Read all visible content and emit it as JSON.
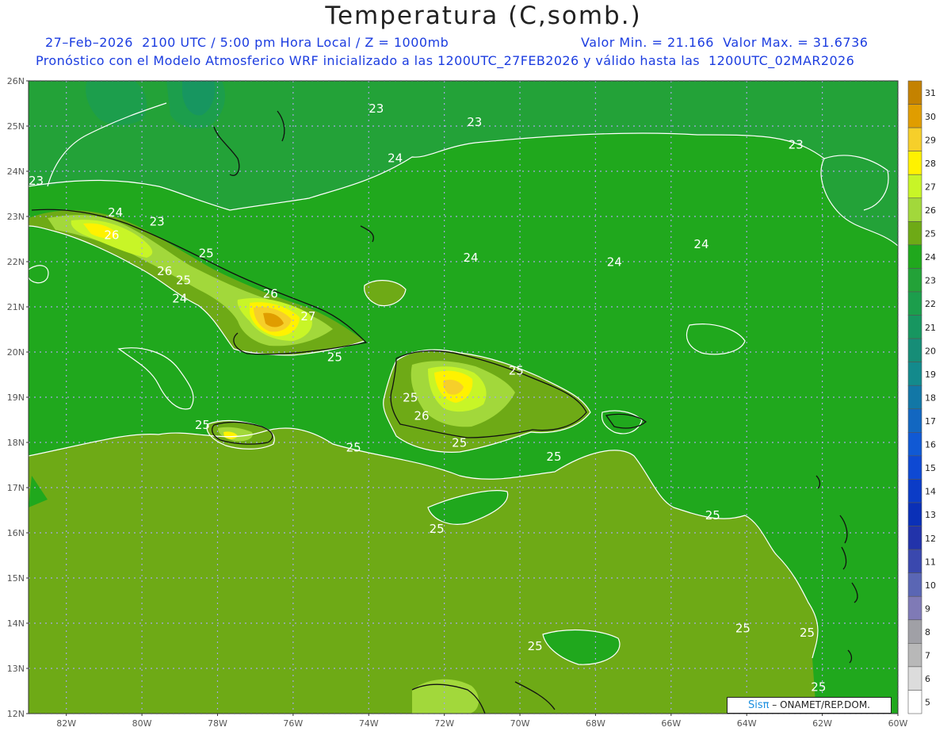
{
  "header": {
    "title": "Temperatura (C,somb.)",
    "line1_left": "27–Feb–2026  2100 UTC / 5:00 pm Hora Local / Z = 1000mb",
    "line1_right": "Valor Min. = 21.166  Valor Max. = 31.6736",
    "line2": "Pronóstico con el Modelo Atmosferico WRF inicializado a las 1200UTC_27FEB2026 y válido hasta las  1200UTC_02MAR2026"
  },
  "map": {
    "lat_range": [
      12,
      26
    ],
    "lon_range": [
      -83,
      -60
    ],
    "lat_labels": [
      "26N",
      "25N",
      "24N",
      "23N",
      "22N",
      "21N",
      "20N",
      "19N",
      "18N",
      "17N",
      "16N",
      "15N",
      "14N",
      "13N",
      "12N"
    ],
    "lon_labels": [
      "82W",
      "80W",
      "78W",
      "76W",
      "74W",
      "72W",
      "70W",
      "68W",
      "66W",
      "64W",
      "62W",
      "60W"
    ],
    "contour_labels": [
      {
        "text": "23",
        "lon": -82.8,
        "lat": 23.7
      },
      {
        "text": "23",
        "lon": -73.8,
        "lat": 25.3
      },
      {
        "text": "23",
        "lon": -71.2,
        "lat": 25.0
      },
      {
        "text": "23",
        "lon": -62.7,
        "lat": 24.5
      },
      {
        "text": "24",
        "lon": -73.3,
        "lat": 24.2
      },
      {
        "text": "24",
        "lon": -80.7,
        "lat": 23.0
      },
      {
        "text": "23",
        "lon": -79.6,
        "lat": 22.8
      },
      {
        "text": "26",
        "lon": -80.8,
        "lat": 22.5
      },
      {
        "text": "25",
        "lon": -78.3,
        "lat": 22.1
      },
      {
        "text": "26",
        "lon": -79.4,
        "lat": 21.7
      },
      {
        "text": "25",
        "lon": -78.9,
        "lat": 21.5
      },
      {
        "text": "24",
        "lon": -79.0,
        "lat": 21.1
      },
      {
        "text": "24",
        "lon": -71.3,
        "lat": 22.0
      },
      {
        "text": "24",
        "lon": -67.5,
        "lat": 21.9
      },
      {
        "text": "24",
        "lon": -65.2,
        "lat": 22.3
      },
      {
        "text": "26",
        "lon": -76.6,
        "lat": 21.2
      },
      {
        "text": "27",
        "lon": -75.6,
        "lat": 20.7
      },
      {
        "text": "25",
        "lon": -74.9,
        "lat": 19.8
      },
      {
        "text": "25",
        "lon": -70.1,
        "lat": 19.5
      },
      {
        "text": "25",
        "lon": -72.9,
        "lat": 18.9
      },
      {
        "text": "26",
        "lon": -72.6,
        "lat": 18.5
      },
      {
        "text": "25",
        "lon": -78.4,
        "lat": 18.3
      },
      {
        "text": "25",
        "lon": -74.4,
        "lat": 17.8
      },
      {
        "text": "25",
        "lon": -71.6,
        "lat": 17.9
      },
      {
        "text": "25",
        "lon": -69.1,
        "lat": 17.6
      },
      {
        "text": "25",
        "lon": -72.2,
        "lat": 16.0
      },
      {
        "text": "25",
        "lon": -64.9,
        "lat": 16.3
      },
      {
        "text": "25",
        "lon": -64.1,
        "lat": 13.8
      },
      {
        "text": "25",
        "lon": -62.4,
        "lat": 13.7
      },
      {
        "text": "25",
        "lon": -69.6,
        "lat": 13.4
      },
      {
        "text": "25",
        "lon": -62.1,
        "lat": 12.5
      }
    ]
  },
  "colorbar": {
    "levels": [
      "31",
      "30",
      "29",
      "28",
      "27",
      "26",
      "25",
      "24",
      "23",
      "22",
      "21",
      "20",
      "19",
      "18",
      "17",
      "16",
      "15",
      "14",
      "13",
      "12",
      "11",
      "10",
      "9",
      "8",
      "7",
      "6",
      "5"
    ],
    "colors": [
      "#c48200",
      "#e09d00",
      "#f6cf2a",
      "#fff200",
      "#c8f527",
      "#a2d83b",
      "#6eaa16",
      "#20a81d",
      "#23a238",
      "#1c9e4c",
      "#179660",
      "#168d77",
      "#138a8c",
      "#1277a6",
      "#1267c1",
      "#1059d4",
      "#0e49d3",
      "#0b3cc7",
      "#0a30b7",
      "#2233aa",
      "#3a48ae",
      "#5a66b4",
      "#7f7ab6",
      "#a0a0a6",
      "#b8b8b8",
      "#dcdcdc",
      "#ffffff"
    ]
  },
  "credit": {
    "brand": "Sisπ",
    "text": "– ONAMET/REP.DOM."
  }
}
